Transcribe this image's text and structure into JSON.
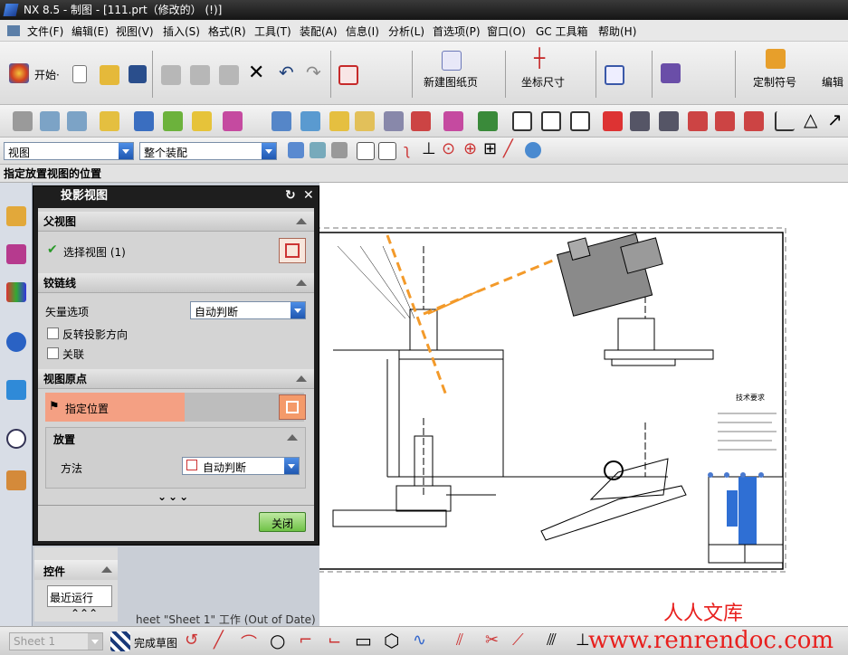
{
  "app": {
    "title": "NX 8.5 - 制图 - [111.prt（修改的）    (!)]"
  },
  "menu": [
    "文件(F)",
    "编辑(E)",
    "视图(V)",
    "插入(S)",
    "格式(R)",
    "工具(T)",
    "装配(A)",
    "信息(I)",
    "分析(L)",
    "首选项(P)",
    "窗口(O)",
    "GC 工具箱",
    "帮助(H)"
  ],
  "toolbar": {
    "start_label": "开始·",
    "new_sheet_label": "新建图纸页",
    "coord_dim_label": "坐标尺寸",
    "custom_symbol_label": "定制符号",
    "edit_label": "编辑"
  },
  "filter": {
    "view_type": "视图",
    "assembly_scope": "整个装配"
  },
  "cue_line": "指定放置视图的位置",
  "dialog": {
    "title": "投影视图",
    "parent_view": {
      "header": "父视图",
      "select_label": "选择视图 (1)"
    },
    "hinge_line": {
      "header": "铰链线",
      "vector_option_label": "矢量选项",
      "vector_option_value": "自动判断",
      "reverse_label": "反转投影方向",
      "associative_label": "关联"
    },
    "view_origin": {
      "header": "视图原点",
      "specify_location_label": "指定位置",
      "placement_header": "放置",
      "method_label": "方法",
      "method_value": "自动判断"
    },
    "close_label": "关闭"
  },
  "nav": {
    "section_label": "控件",
    "recent_label": "最近运行"
  },
  "status": {
    "sheet_status": "heet \"Sheet 1\" 工作 (Out of Date)",
    "sheet_combo": "Sheet 1",
    "finish_sketch_label": "完成草图"
  },
  "drawing": {
    "tech_req_title": "技术要求"
  },
  "watermark": {
    "cn": "人人文库",
    "url": "www.renrendoc.com"
  }
}
